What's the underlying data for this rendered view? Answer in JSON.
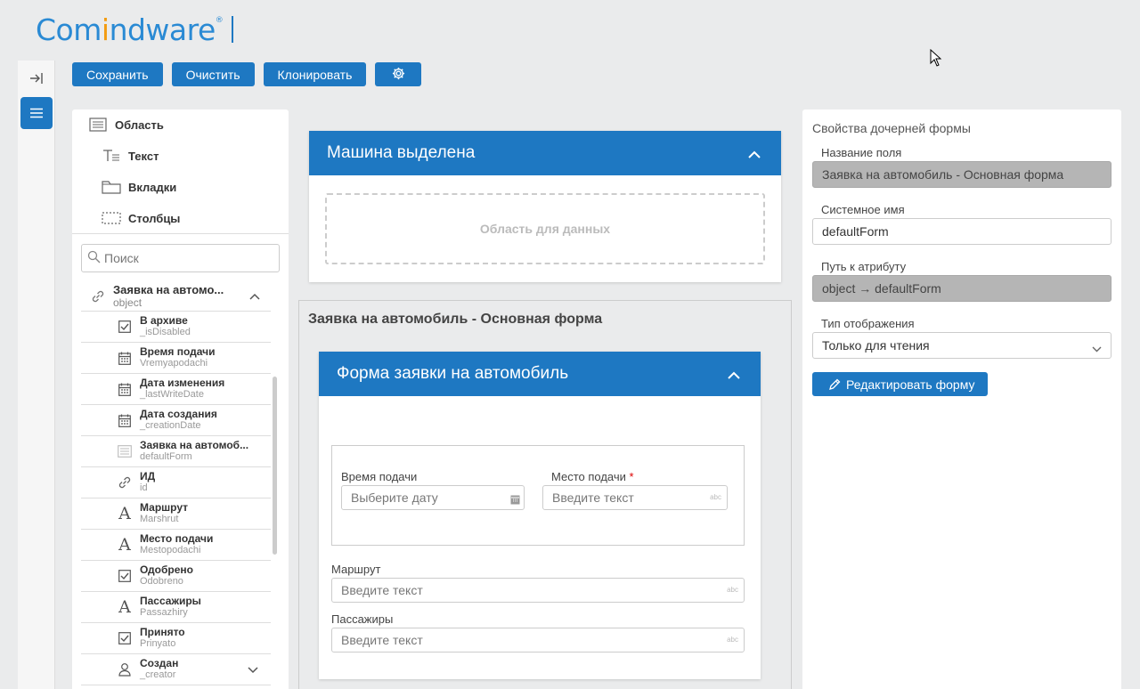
{
  "logo": {
    "part1": "Com",
    "part2": "i",
    "part3": "ndware",
    "mark": "®"
  },
  "rail": {
    "collapse_icon": "collapse-right-icon",
    "menu_icon": "menu-icon"
  },
  "toolbar": {
    "save_label": "Сохранить",
    "clear_label": "Очистить",
    "clone_label": "Клонировать",
    "settings_icon": "gear-icon"
  },
  "palette": {
    "items": [
      {
        "label": "Область",
        "icon": "area-icon"
      },
      {
        "label": "Текст",
        "icon": "text-icon"
      },
      {
        "label": "Вкладки",
        "icon": "tabs-icon"
      },
      {
        "label": "Столбцы",
        "icon": "columns-icon"
      }
    ]
  },
  "search": {
    "placeholder": "Поиск"
  },
  "tree": {
    "root": {
      "title": "Заявка на автомо...",
      "subtitle": "object"
    },
    "items": [
      {
        "title": "В архиве",
        "subtitle": "_isDisabled",
        "icon": "checkbox-icon"
      },
      {
        "title": "Время подачи",
        "subtitle": "Vremyapodachi",
        "icon": "calendar-icon"
      },
      {
        "title": "Дата изменения",
        "subtitle": "_lastWriteDate",
        "icon": "calendar-icon"
      },
      {
        "title": "Дата создания",
        "subtitle": "_creationDate",
        "icon": "calendar-icon"
      },
      {
        "title": "Заявка на автомоб...",
        "subtitle": "defaultForm",
        "icon": "form-icon"
      },
      {
        "title": "ИД",
        "subtitle": "id",
        "icon": "link-icon"
      },
      {
        "title": "Маршрут",
        "subtitle": "Marshrut",
        "icon": "text-a-icon"
      },
      {
        "title": "Место подачи",
        "subtitle": "Mestopodachi",
        "icon": "text-a-icon"
      },
      {
        "title": "Одобрено",
        "subtitle": "Odobreno",
        "icon": "checkbox-icon"
      },
      {
        "title": "Пассажиры",
        "subtitle": "Passazhiry",
        "icon": "text-a-icon"
      },
      {
        "title": "Принято",
        "subtitle": "Prinyato",
        "icon": "checkbox-icon"
      },
      {
        "title": "Создан",
        "subtitle": "_creator",
        "icon": "user-icon"
      }
    ]
  },
  "center": {
    "card1": {
      "title": "Машина выделена",
      "dropzone": "Область для данных"
    },
    "subform": {
      "title": "Заявка на автомобиль - Основная форма"
    },
    "card2": {
      "title": "Форма заявки на автомобиль"
    },
    "fields": {
      "time": {
        "label": "Время подачи",
        "placeholder": "Выберите дату"
      },
      "place": {
        "label": "Место подачи",
        "required": "*",
        "placeholder": "Введите текст",
        "suffix": "abc"
      },
      "route": {
        "label": "Маршрут",
        "placeholder": "Введите текст",
        "suffix": "abc"
      },
      "passengers": {
        "label": "Пассажиры",
        "placeholder": "Введите текст",
        "suffix": "abc"
      }
    }
  },
  "properties": {
    "title": "Свойства дочерней формы",
    "field_name_label": "Название поля",
    "field_name_value": "Заявка на автомобиль - Основная форма",
    "system_name_label": "Системное имя",
    "system_name_value": "defaultForm",
    "attr_path_label": "Путь к атрибуту",
    "attr_path_value": "object → defaultForm",
    "display_type_label": "Тип отображения",
    "display_type_value": "Только для чтения",
    "edit_button_label": "Редактировать форму"
  },
  "colors": {
    "accent": "#1e78c2",
    "logo_blue": "#2a8ad4",
    "logo_orange": "#f39c12",
    "required": "#dd0000"
  }
}
